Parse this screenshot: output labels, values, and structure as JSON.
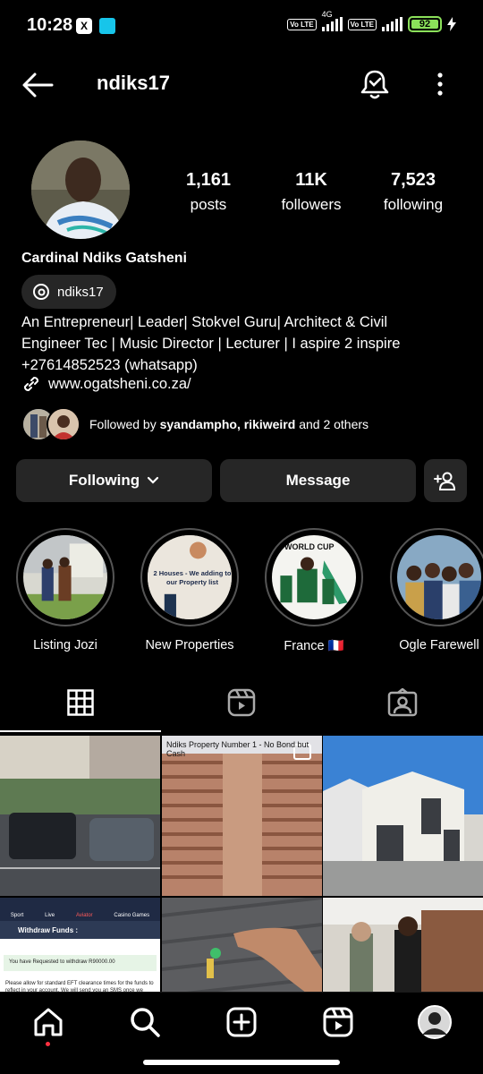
{
  "status_bar": {
    "time": "10:28",
    "x_label": "X",
    "signal_4g": "4G",
    "volte_label": "Vo LTE",
    "battery": "92"
  },
  "header": {
    "username": "ndiks17"
  },
  "profile": {
    "stats": [
      {
        "value": "1,161",
        "label": "posts"
      },
      {
        "value": "11K",
        "label": "followers"
      },
      {
        "value": "7,523",
        "label": "following"
      }
    ],
    "full_name": "Cardinal Ndiks Gatsheni",
    "threads_handle": "ndiks17",
    "bio_lines": [
      "An Entrepreneur| Leader| Stokvel Guru| Architect & Civil",
      "Engineer Tec | Music Director | Lecturer | I aspire 2 inspire",
      "+27614852523  (whatsapp)"
    ],
    "website": "www.ogatsheni.co.za/",
    "followed_by": {
      "prefix": "Followed by ",
      "names": "syandampho, rikiweird",
      "suffix": " and 2 others"
    }
  },
  "actions": {
    "following": "Following",
    "message": "Message"
  },
  "highlights": [
    {
      "label": "Listing Jozi"
    },
    {
      "label": "New Properties",
      "inner_text": "2 Houses - We adding to our Property list"
    },
    {
      "label": "France 🇫🇷",
      "inner_text": "WORLD CUP"
    },
    {
      "label": "Ogle Farewell"
    }
  ],
  "grid_posts": [
    {
      "caption": ""
    },
    {
      "caption": "Ndiks Property Number 1 - No Bond but Cash"
    },
    {
      "caption": ""
    },
    {
      "caption": "Withdraw Funds :",
      "menu": [
        "Sport",
        "Live",
        "Aviator",
        "Casino Games"
      ],
      "notice": "You have Requested to withdraw R90000.00",
      "body": "Please allow for standard EFT clearance times for the funds to reflect in your account. We will send you an SMS once we have"
    },
    {
      "caption": ""
    },
    {
      "caption": ""
    }
  ]
}
